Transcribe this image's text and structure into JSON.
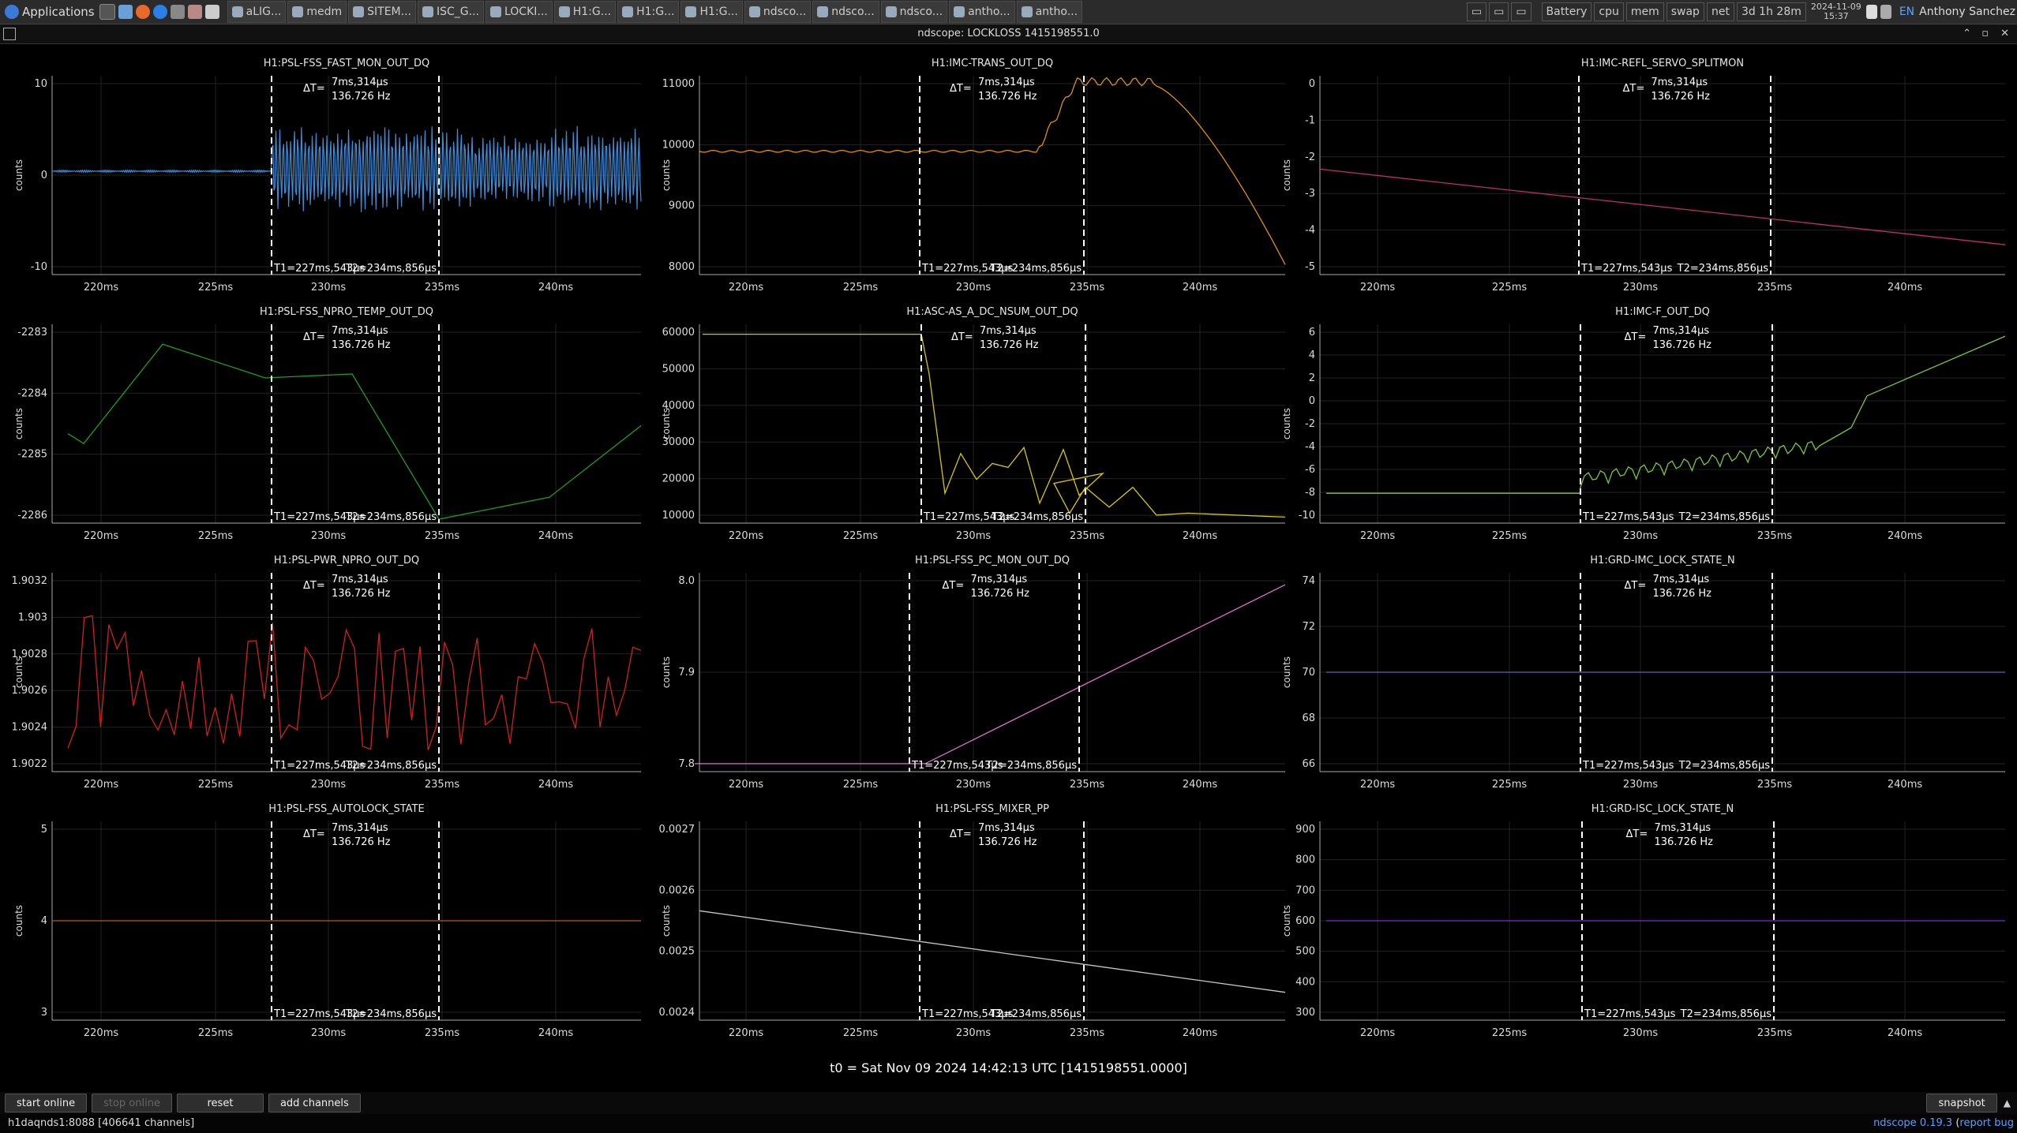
{
  "taskbar": {
    "apps_label": "Applications",
    "tasks": [
      "aLIG...",
      "medm",
      "SITEM...",
      "ISC_G...",
      "LOCKI...",
      "H1:G...",
      "H1:G...",
      "H1:G...",
      "ndsco...",
      "ndsco...",
      "ndsco...",
      "antho...",
      "antho..."
    ],
    "monitors": [
      "Battery",
      "cpu",
      "mem",
      "swap",
      "net"
    ],
    "uptime": "3d 1h 28m",
    "date": "2024-11-09",
    "time": "15:37",
    "lang": "EN",
    "user": "Anthony Sanchez"
  },
  "window": {
    "title": "ndscope: LOCKLOSS 1415198551.0"
  },
  "cursor": {
    "dt": "ΔT=",
    "dt_time": "7ms,314μs",
    "dt_freq": "136.726 Hz",
    "t1": "T1=227ms,543μs",
    "t2": "T2=234ms,856μs"
  },
  "xticks": [
    "220ms",
    "225ms",
    "230ms",
    "235ms",
    "240ms"
  ],
  "ylabel": "counts",
  "plots": [
    {
      "title": "H1:PSL-FSS_FAST_MON_OUT_DQ",
      "color": "#3a8fd8",
      "yticks": [
        "10",
        "0",
        "-10"
      ]
    },
    {
      "title": "H1:IMC-TRANS_OUT_DQ",
      "color": "#e0900a",
      "yticks": [
        "11000",
        "10000",
        "9000",
        "8000"
      ]
    },
    {
      "title": "H1:IMC-REFL_SERVO_SPLITMON",
      "color": "#c0306a",
      "yticks": [
        "0",
        "-1",
        "-2",
        "-3",
        "-4",
        "-5"
      ]
    },
    {
      "title": "H1:PSL-FSS_NPRO_TEMP_OUT_DQ",
      "color": "#1fa01f",
      "yticks": [
        "-2283",
        "-2284",
        "-2285",
        "-2286"
      ]
    },
    {
      "title": "H1:ASC-AS_A_DC_NSUM_OUT_DQ",
      "color": "#d8c800",
      "yticks": [
        "60000",
        "50000",
        "40000",
        "30000",
        "20000",
        "10000"
      ]
    },
    {
      "title": "H1:IMC-F_OUT_DQ",
      "color": "#7ac83a",
      "yticks": [
        "6",
        "4",
        "2",
        "0",
        "-2",
        "-4",
        "-6",
        "-8",
        "-10"
      ]
    },
    {
      "title": "H1:PSL-PWR_NPRO_OUT_DQ",
      "color": "#d02020",
      "yticks": [
        "1.9032",
        "1.903",
        "1.9028",
        "1.9026",
        "1.9024",
        "1.9022"
      ]
    },
    {
      "title": "H1:PSL-FSS_PC_MON_OUT_DQ",
      "color": "#e070d0",
      "yticks": [
        "8.0",
        "7.9",
        "7.8"
      ]
    },
    {
      "title": "H1:GRD-IMC_LOCK_STATE_N",
      "color": "#6060c0",
      "yticks": [
        "74",
        "72",
        "70",
        "68",
        "66"
      ]
    },
    {
      "title": "H1:PSL-FSS_AUTOLOCK_STATE",
      "color": "#c05030",
      "yticks": [
        "5",
        "4",
        "3"
      ]
    },
    {
      "title": "H1:PSL-FSS_MIXER_PP",
      "color": "#c8c8c8",
      "yticks": [
        "0.0027",
        "0.0026",
        "0.0025",
        "0.0024"
      ]
    },
    {
      "title": "H1:GRD-ISC_LOCK_STATE_N",
      "color": "#7a2ad8",
      "yticks": [
        "900",
        "800",
        "700",
        "600",
        "500",
        "400",
        "300"
      ]
    }
  ],
  "t0": "t0 = Sat Nov 09 2024 14:42:13 UTC [1415198551.0000]",
  "buttons": {
    "start_online": "start online",
    "stop_online": "stop online",
    "reset": "reset",
    "add_channels": "add channels",
    "snapshot": "snapshot"
  },
  "status": {
    "server": "h1daqnds1:8088  [406641 channels]",
    "app": "ndscope",
    "version": "0.19.3",
    "report": "report bug"
  }
}
